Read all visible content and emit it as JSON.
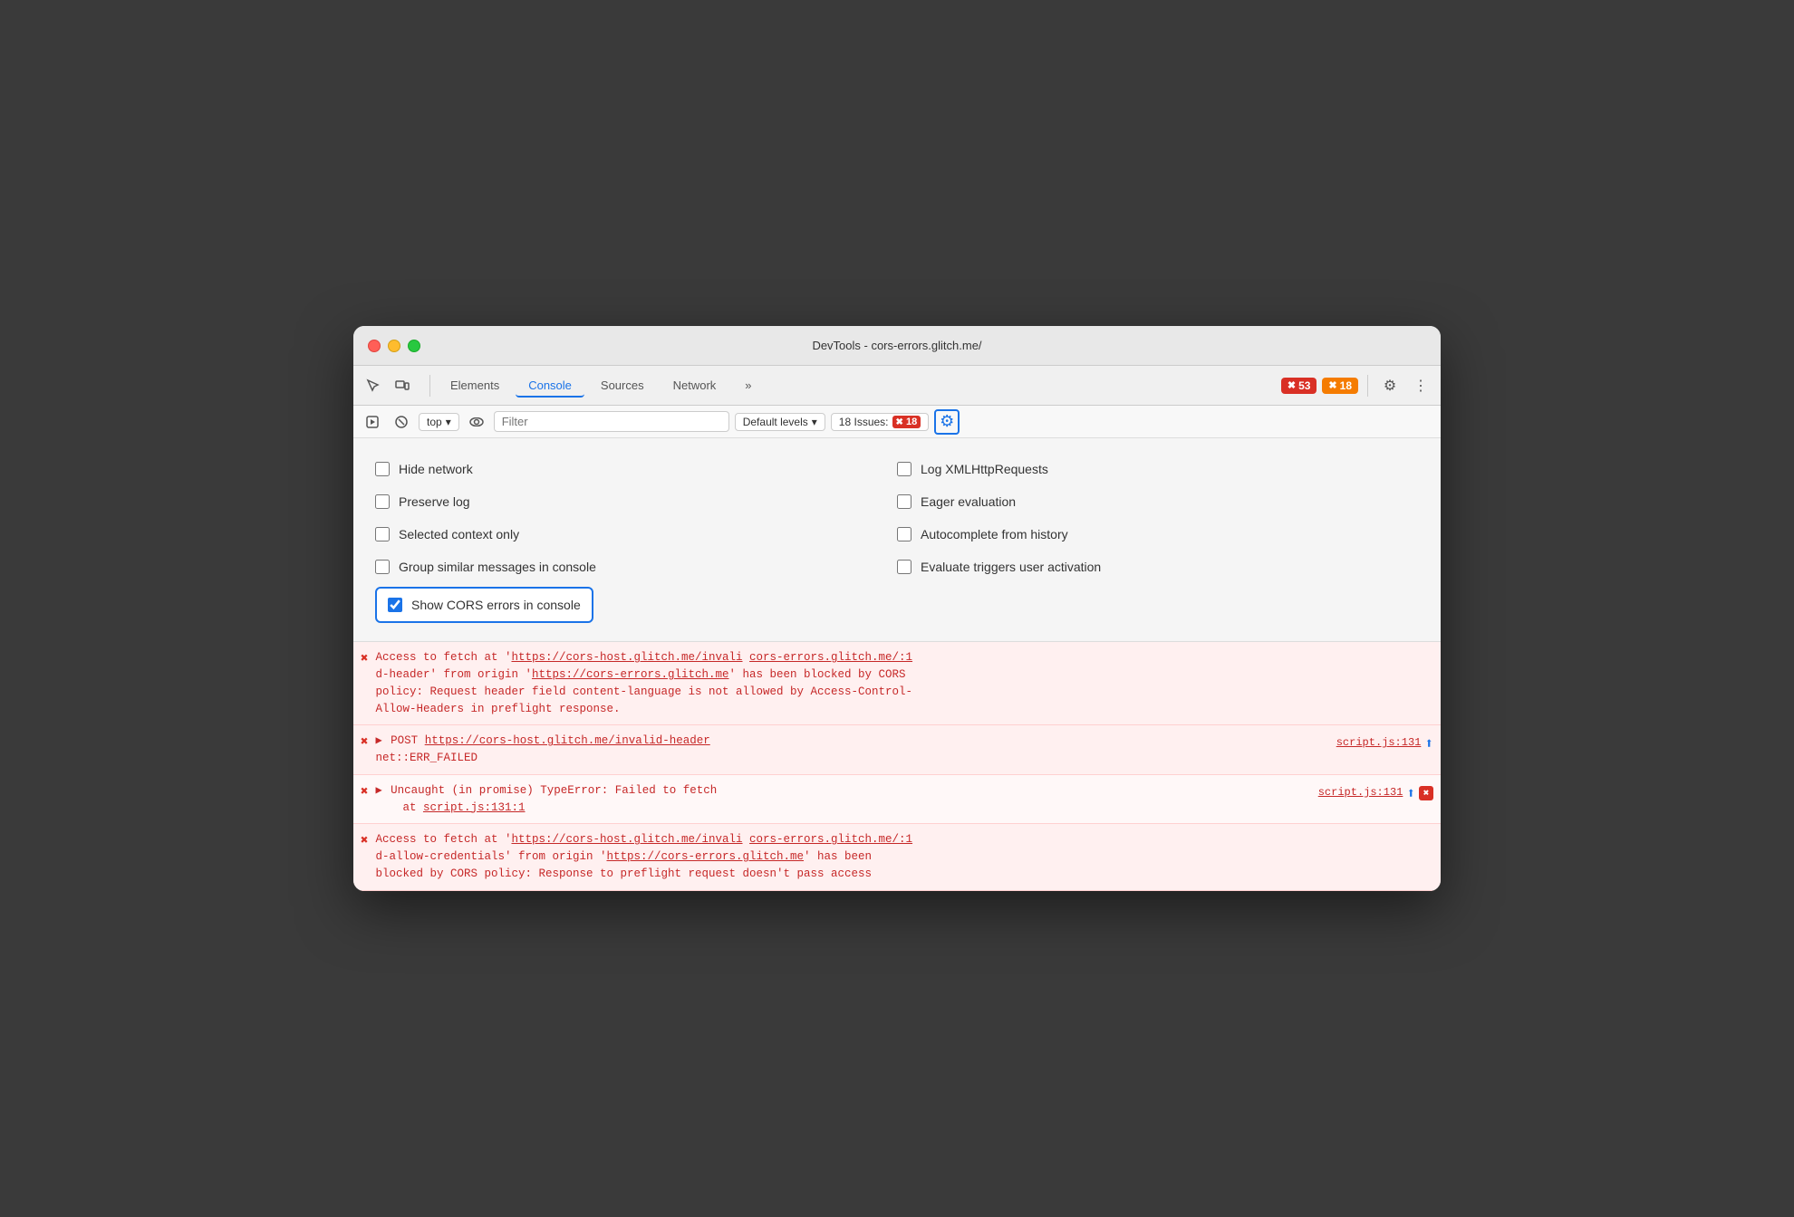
{
  "window": {
    "title": "DevTools - cors-errors.glitch.me/"
  },
  "toolbar": {
    "tabs": [
      {
        "id": "elements",
        "label": "Elements",
        "active": false
      },
      {
        "id": "console",
        "label": "Console",
        "active": true
      },
      {
        "id": "sources",
        "label": "Sources",
        "active": false
      },
      {
        "id": "network",
        "label": "Network",
        "active": false
      }
    ],
    "more_label": "»",
    "errors_count": "53",
    "warnings_count": "18",
    "gear_label": "⚙",
    "more_dots": "⋮"
  },
  "console_toolbar": {
    "top_label": "top",
    "filter_placeholder": "Filter",
    "default_levels": "Default levels",
    "issues_label": "18 Issues:",
    "issues_count": "18"
  },
  "settings": {
    "options": [
      {
        "id": "hide-network",
        "label": "Hide network",
        "checked": false
      },
      {
        "id": "log-xmlhttp",
        "label": "Log XMLHttpRequests",
        "checked": false
      },
      {
        "id": "preserve-log",
        "label": "Preserve log",
        "checked": false
      },
      {
        "id": "eager-eval",
        "label": "Eager evaluation",
        "checked": false
      },
      {
        "id": "selected-context",
        "label": "Selected context only",
        "checked": false
      },
      {
        "id": "autocomplete-history",
        "label": "Autocomplete from history",
        "checked": false
      },
      {
        "id": "group-similar",
        "label": "Group similar messages in console",
        "checked": false
      },
      {
        "id": "eval-triggers",
        "label": "Evaluate triggers user activation",
        "checked": false
      }
    ],
    "cors_option": {
      "id": "show-cors",
      "label": "Show CORS errors in console",
      "checked": true
    }
  },
  "console_errors": [
    {
      "id": "error1",
      "type": "error",
      "text": "Access to fetch at 'https://cors-host.glitch.me/invali cors-errors.glitch.me/:1\nd-header' from origin 'https://cors-errors.glitch.me' has been blocked by CORS\npolicy: Request header field content-language is not allowed by Access-Control-\nAllow-Headers in preflight response.",
      "has_source": false
    },
    {
      "id": "error2",
      "type": "error",
      "expandable": true,
      "main_text": "POST https://cors-host.glitch.me/invalid-header",
      "sub_text": "net::ERR_FAILED",
      "source": "script.js:131",
      "has_upload": true,
      "has_close": false
    },
    {
      "id": "error3",
      "type": "error",
      "expandable": true,
      "main_text": "Uncaught (in promise) TypeError: Failed to fetch\n    at script.js:131:1",
      "source": "script.js:131",
      "has_upload": true,
      "has_close": true
    },
    {
      "id": "error4",
      "type": "error",
      "text": "Access to fetch at 'https://cors-host.glitch.me/invali cors-errors.glitch.me/:1\nd-allow-credentials' from origin 'https://cors-errors.glitch.me' has been\nblocked by CORS policy: Response to preflight request doesn't pass access",
      "has_source": false
    }
  ]
}
